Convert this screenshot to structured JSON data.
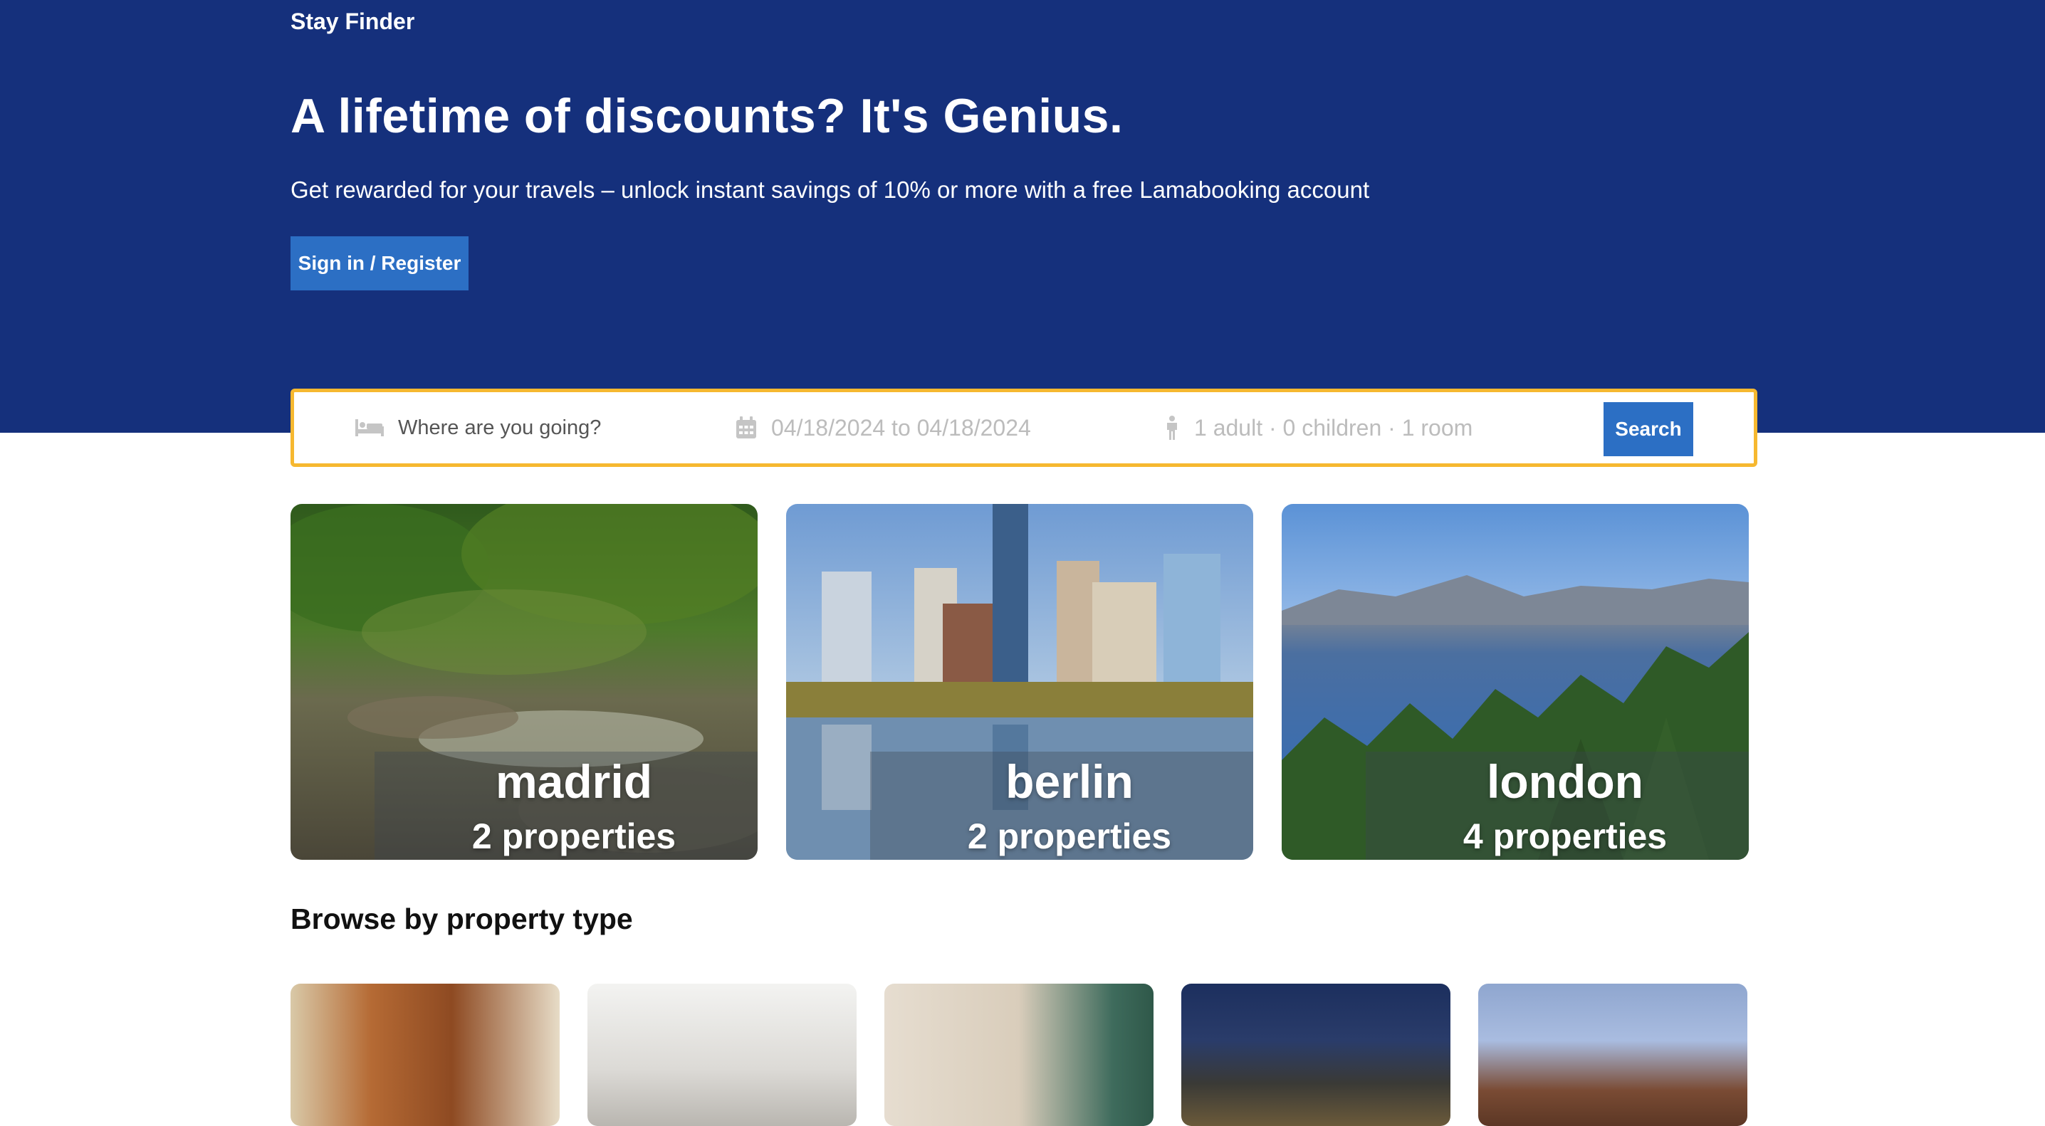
{
  "brand": "Stay Finder",
  "hero": {
    "title": "A lifetime of discounts? It's Genius.",
    "subtitle": "Get rewarded for your travels – unlock instant savings of 10% or more with a free Lamabooking account",
    "signin_label": "Sign in / Register"
  },
  "search": {
    "destination_placeholder": "Where are you going?",
    "dates": "04/18/2024 to 04/18/2024",
    "guests": "1 adult · 0 children · 1 room",
    "button_label": "Search"
  },
  "cities": [
    {
      "name": "madrid",
      "properties": "2 properties"
    },
    {
      "name": "berlin",
      "properties": "2 properties"
    },
    {
      "name": "london",
      "properties": "4 properties"
    }
  ],
  "browse": {
    "title": "Browse by property type"
  },
  "colors": {
    "hero_bg": "#15307c",
    "accent_button": "#2c6fc4",
    "search_border": "#f6b830"
  }
}
